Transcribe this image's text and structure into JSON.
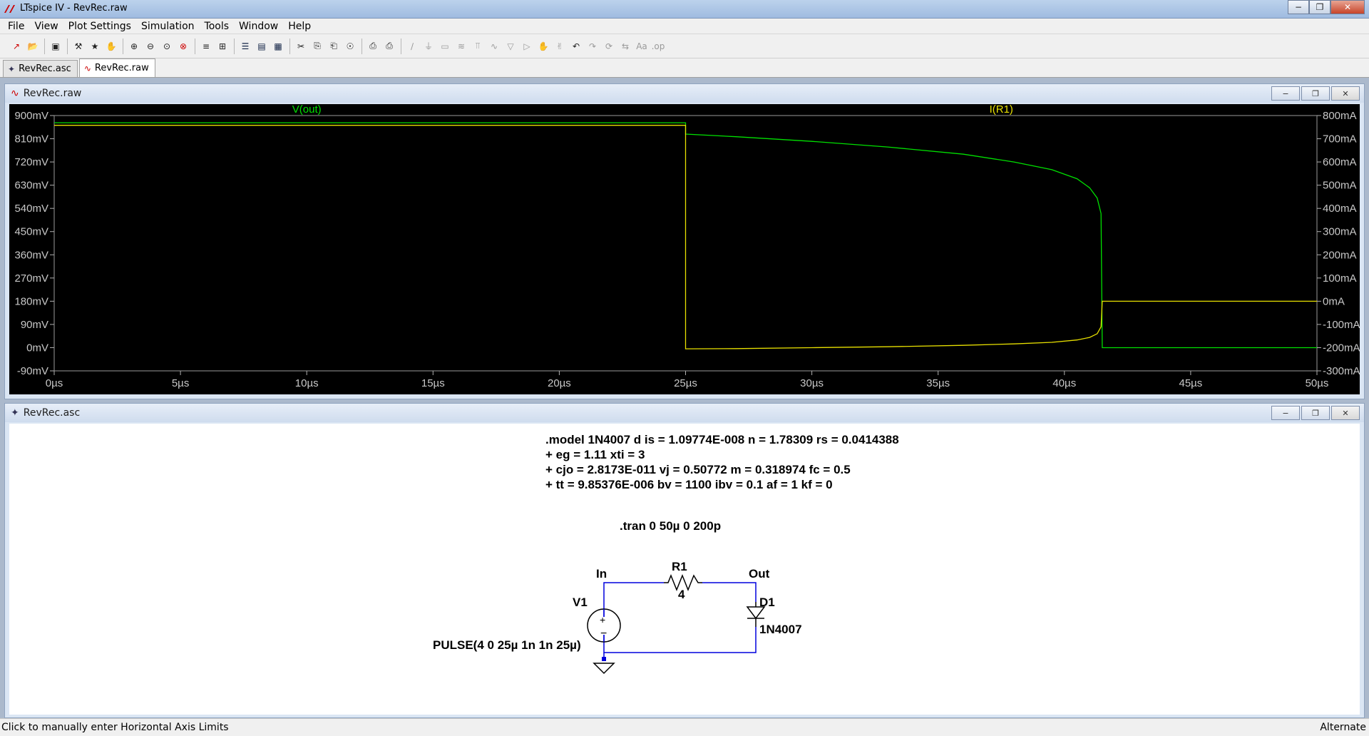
{
  "window": {
    "title": "LTspice IV - RevRec.raw"
  },
  "menu": [
    "File",
    "View",
    "Plot Settings",
    "Simulation",
    "Tools",
    "Window",
    "Help"
  ],
  "toolbar_icons": [
    "new-schematic-icon",
    "open-icon",
    "save-icon",
    "control-panel-icon",
    "run-icon",
    "halt-icon",
    "zoom-in-icon",
    "zoom-out-icon",
    "zoom-full-icon",
    "zoom-cancel-icon",
    "autorange-icon",
    "grid-icon",
    "tile-horizontal-icon",
    "tile-vertical-icon",
    "cascade-icon",
    "cut-icon",
    "copy-icon",
    "paste-icon",
    "find-icon",
    "print-preview-icon",
    "print-icon",
    "wire-icon",
    "ground-icon",
    "label-icon",
    "resistor-icon",
    "capacitor-icon",
    "inductor-icon",
    "diode-icon",
    "component-icon",
    "move-icon",
    "drag-icon",
    "undo-icon",
    "redo-icon",
    "rotate-icon",
    "mirror-icon",
    "text-icon",
    "spice-directive-icon"
  ],
  "tabs": [
    {
      "label": "RevRec.asc",
      "icon": "schematic-icon",
      "active": false
    },
    {
      "label": "RevRec.raw",
      "icon": "waveform-icon",
      "active": true
    }
  ],
  "plot_window": {
    "title": "RevRec.raw"
  },
  "schematic_window": {
    "title": "RevRec.asc"
  },
  "chart_data": {
    "type": "line",
    "x_label_unit": "µs",
    "xlim": [
      0,
      50
    ],
    "x_ticks": [
      "0µs",
      "5µs",
      "10µs",
      "15µs",
      "20µs",
      "25µs",
      "30µs",
      "35µs",
      "40µs",
      "45µs",
      "50µs"
    ],
    "left_axis": {
      "unit": "mV",
      "ylim": [
        -90,
        900
      ],
      "ticks": [
        "900mV",
        "810mV",
        "720mV",
        "630mV",
        "540mV",
        "450mV",
        "360mV",
        "270mV",
        "180mV",
        "90mV",
        "0mV",
        "-90mV"
      ]
    },
    "right_axis": {
      "unit": "mA",
      "ylim": [
        -300,
        800
      ],
      "ticks": [
        "800mA",
        "700mA",
        "600mA",
        "500mA",
        "400mA",
        "300mA",
        "200mA",
        "100mA",
        "0mA",
        "-100mA",
        "-200mA",
        "-300mA"
      ]
    },
    "series": [
      {
        "name": "V(out)",
        "axis": "left",
        "color": "#00e000",
        "x": [
          0,
          25,
          25,
          27,
          30,
          33,
          36,
          38,
          39.5,
          40.5,
          41.0,
          41.3,
          41.45,
          41.5,
          41.5,
          50
        ],
        "y": [
          872,
          872,
          828,
          818,
          800,
          778,
          750,
          720,
          690,
          655,
          620,
          580,
          520,
          0,
          0,
          0
        ]
      },
      {
        "name": "I(R1)",
        "axis": "right",
        "color": "#e8e000",
        "x": [
          0,
          25,
          25,
          27,
          30,
          33,
          36,
          38,
          39.5,
          40.5,
          41.0,
          41.3,
          41.45,
          41.5,
          41.5,
          50
        ],
        "y": [
          758,
          758,
          -205,
          -204,
          -200,
          -196,
          -190,
          -184,
          -177,
          -167,
          -156,
          -140,
          -110,
          0,
          0,
          0
        ]
      }
    ]
  },
  "schematic": {
    "model_lines": [
      ".model 1N4007 d is = 1.09774E-008 n = 1.78309 rs = 0.0414388",
      "+ eg = 1.11 xti = 3",
      "+ cjo = 2.8173E-011 vj = 0.50772 m = 0.318974 fc = 0.5",
      "+ tt = 9.85376E-006 bv = 1100 ibv = 0.1 af = 1 kf = 0"
    ],
    "tran": ".tran 0 50µ 0 200p",
    "net_in": "In",
    "net_out": "Out",
    "r1_name": "R1",
    "r1_value": "4",
    "v1_name": "V1",
    "v1_value": "PULSE(4 0 25µ 1n 1n 25µ)",
    "d1_name": "D1",
    "d1_value": "1N4007"
  },
  "status": {
    "left": "Click to manually enter Horizontal Axis Limits",
    "right": "Alternate"
  }
}
